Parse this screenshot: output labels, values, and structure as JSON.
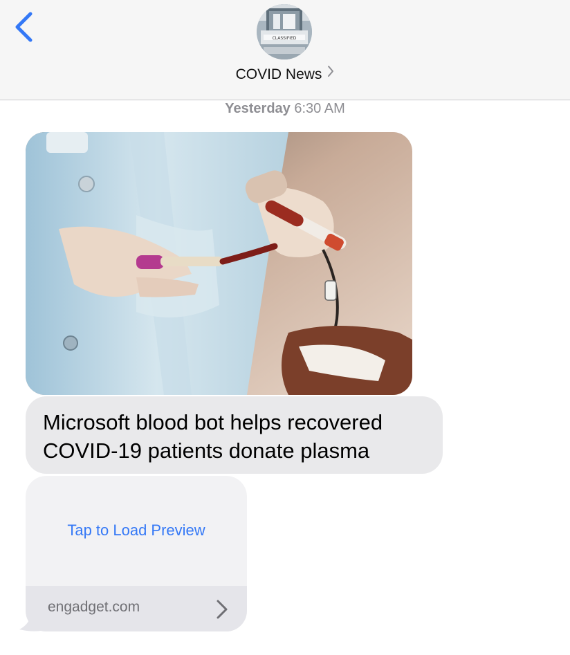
{
  "header": {
    "contact_name": "COVID News",
    "avatar_sign_text": "CLASSIFIED"
  },
  "timestamp": {
    "day": "Yesterday",
    "time": "6:30 AM"
  },
  "messages": {
    "headline": "Microsoft blood bot helps recovered COVID-19 patients donate plasma",
    "preview_action": "Tap to Load Preview",
    "link_domain": "engadget.com"
  },
  "colors": {
    "accent": "#3478f6",
    "received_bubble": "#e9e9eb",
    "timestamp": "#8e8e93"
  },
  "icons": {
    "back": "chevron-left-icon",
    "contact_chevron": "chevron-right-icon",
    "link_chevron": "chevron-right-icon"
  }
}
